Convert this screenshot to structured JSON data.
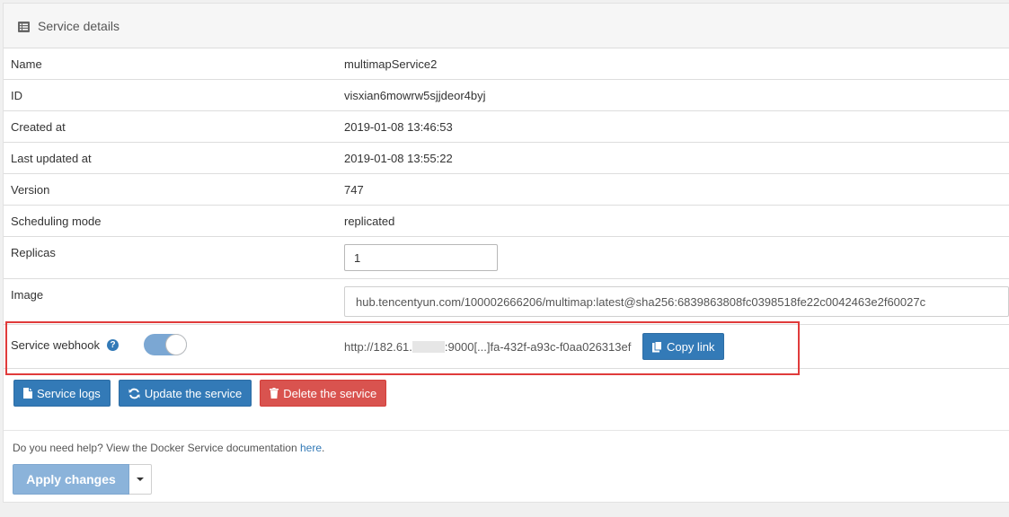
{
  "panel": {
    "title": "Service details"
  },
  "details": {
    "rows": [
      {
        "label": "Name",
        "value": "multimapService2"
      },
      {
        "label": "ID",
        "value": "visxian6mowrw5sjjdeor4byj"
      },
      {
        "label": "Created at",
        "value": "2019-01-08 13:46:53"
      },
      {
        "label": "Last updated at",
        "value": "2019-01-08 13:55:22"
      },
      {
        "label": "Version",
        "value": "747"
      },
      {
        "label": "Scheduling mode",
        "value": "replicated"
      }
    ],
    "replicas": {
      "label": "Replicas",
      "value": "1"
    },
    "image": {
      "label": "Image",
      "value": "hub.tencentyun.com/100002666206/multimap:latest@sha256:6839863808fc0398518fe22c0042463e2f60027c"
    },
    "webhook": {
      "label": "Service webhook",
      "help": "?",
      "enabled": true,
      "url_prefix": "http://182.61.",
      "url_suffix": ":9000[...]fa-432f-a93c-f0aa026313ef",
      "copy_label": "Copy link"
    }
  },
  "actions": {
    "logs_label": "Service logs",
    "update_label": "Update the service",
    "delete_label": "Delete the service"
  },
  "help": {
    "text": "Do you need help? View the Docker Service documentation ",
    "link": "here",
    "suffix": "."
  },
  "apply": {
    "label": "Apply changes"
  },
  "colors": {
    "primary": "#337ab7",
    "danger": "#d9534f",
    "highlight": "#e03b3b",
    "apply_disabled": "#8bb3da"
  }
}
